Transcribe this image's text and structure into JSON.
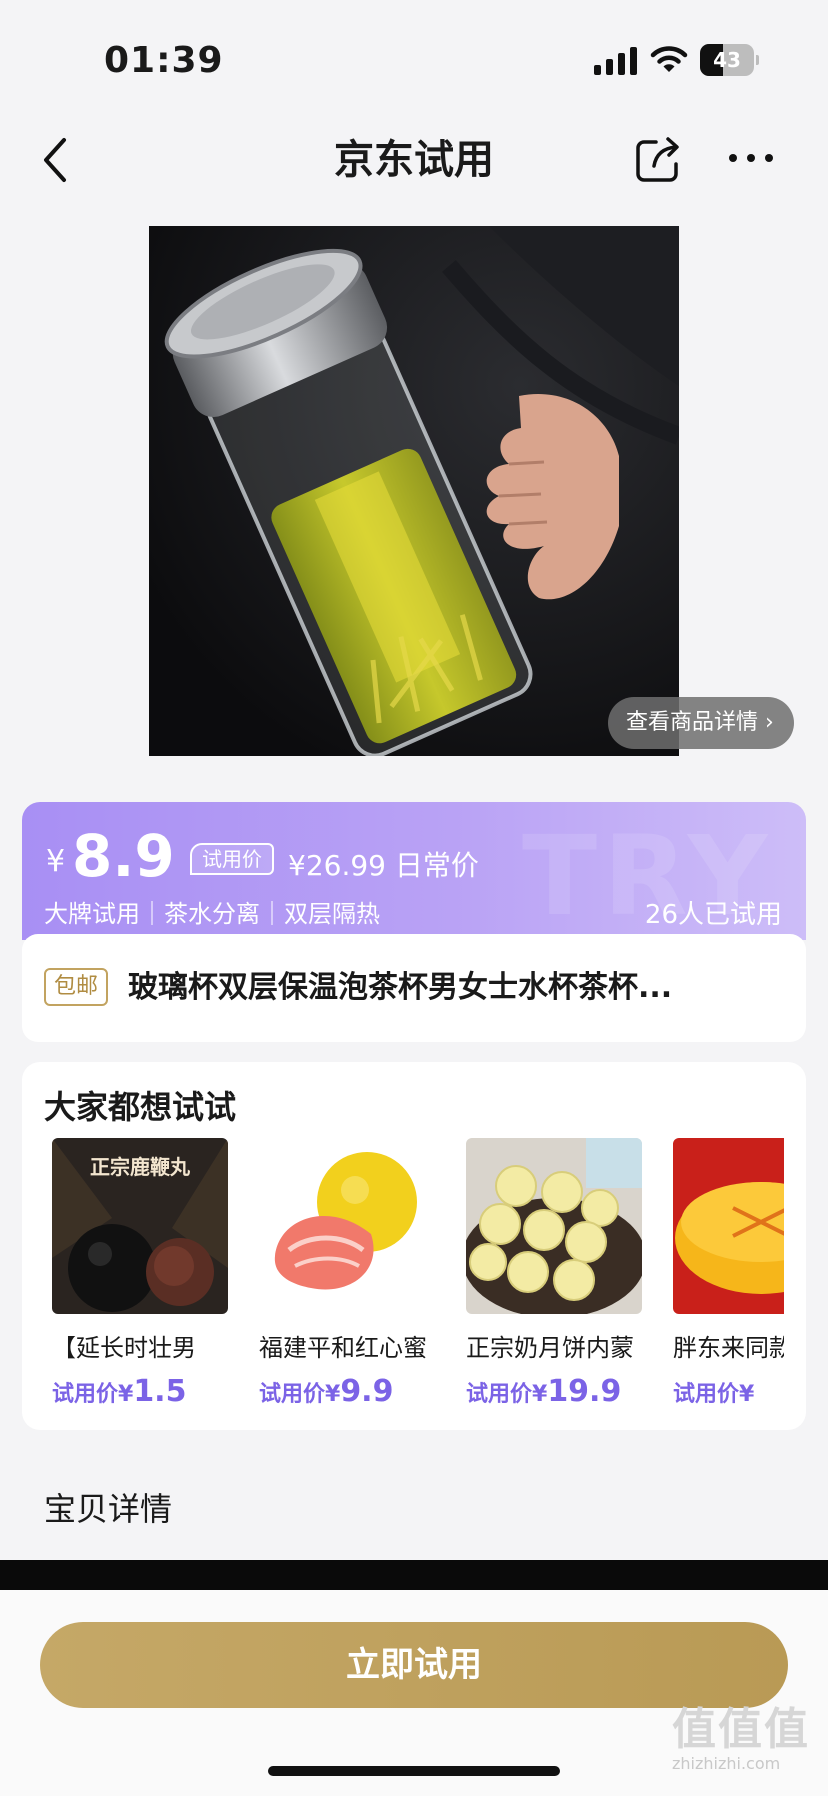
{
  "status_bar": {
    "time": "01:39",
    "battery": "43",
    "battery_level": 0.43
  },
  "nav": {
    "title": "京东试用"
  },
  "product": {
    "detail_link": "查看商品详情 ›"
  },
  "price_card": {
    "currency": "¥",
    "price": "8.9",
    "trial_tag": "试用价",
    "original_price": "¥26.99 日常价",
    "tags": "大牌试用｜茶水分离｜双层隔热",
    "tried_count": "26人已试用"
  },
  "title_card": {
    "badge": "包邮",
    "title": "玻璃杯双层保温泡茶杯男女士水杯茶杯..."
  },
  "recommendations": {
    "heading": "大家都想试试",
    "items": [
      {
        "name": "【延长时壮男",
        "price_label": "试用价¥",
        "price": "1.5",
        "thumb_text": "正宗鹿鞭丸"
      },
      {
        "name": "福建平和红心蜜",
        "price_label": "试用价¥",
        "price": "9.9"
      },
      {
        "name": "正宗奶月饼内蒙",
        "price_label": "试用价¥",
        "price": "19.9"
      },
      {
        "name": "胖东来同款",
        "price_label": "试用价¥",
        "price": ""
      }
    ]
  },
  "details": {
    "heading": "宝贝详情"
  },
  "cta": {
    "label": "立即试用"
  },
  "watermark": {
    "glyphs": "值值值",
    "url": "zhizhizhi.com"
  },
  "colors": {
    "accent_purple": "#7b63e6",
    "gold": "#c5a867",
    "price_card_bg": "#a88ff4"
  }
}
